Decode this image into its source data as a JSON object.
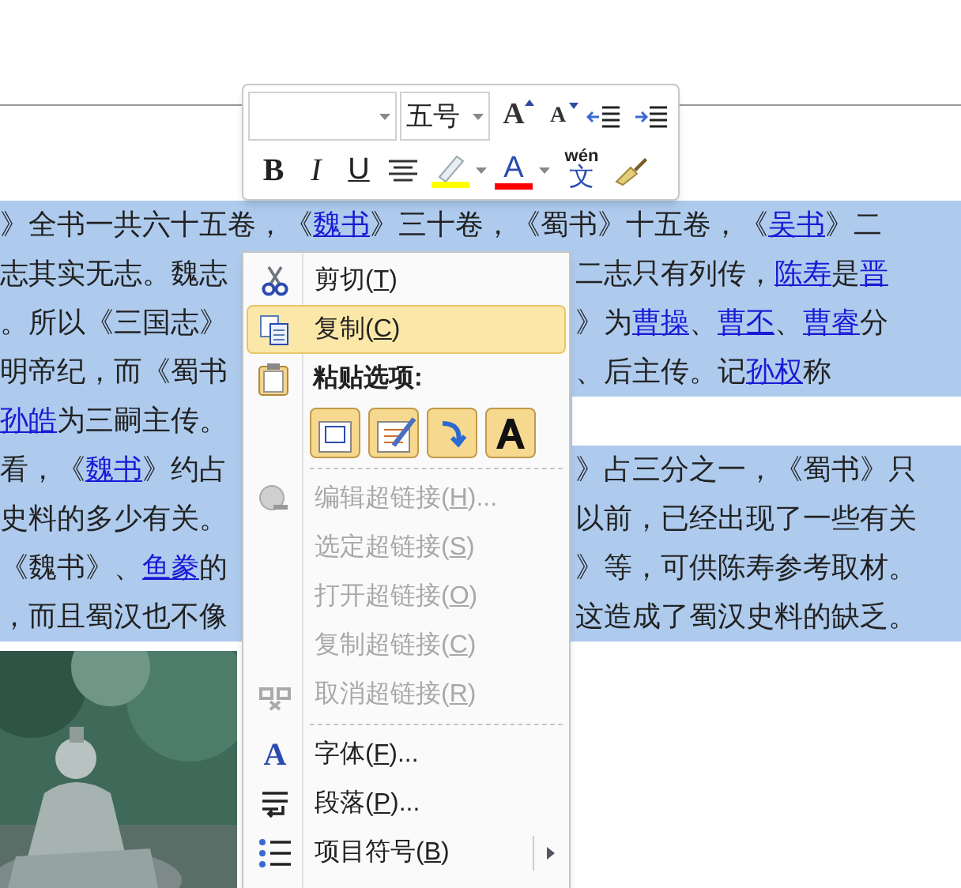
{
  "document": {
    "lines": [
      {
        "kind": "full",
        "left": {
          "selected": true,
          "runs": [
            {
              "text": "》全书一共六十五卷，《"
            },
            {
              "text": "魏书",
              "link": true
            },
            {
              "text": "》三十卷，《蜀书》十五卷，《"
            },
            {
              "text": "吴书",
              "link": true
            },
            {
              "text": "》二"
            }
          ]
        }
      },
      {
        "kind": "split",
        "left": {
          "selected": true,
          "runs": [
            {
              "text": "志其实无志。魏志"
            }
          ]
        },
        "right": {
          "selected": true,
          "runs": [
            {
              "text": "二志只有列传，"
            },
            {
              "text": "陈寿",
              "link": true
            },
            {
              "text": "是"
            },
            {
              "text": "晋",
              "link": true
            }
          ]
        }
      },
      {
        "kind": "split",
        "left": {
          "selected": true,
          "runs": [
            {
              "text": "。所以《三国志》"
            }
          ]
        },
        "right": {
          "selected": true,
          "runs": [
            {
              "text": "》为"
            },
            {
              "text": "曹操",
              "link": true
            },
            {
              "text": "、"
            },
            {
              "text": "曹丕",
              "link": true
            },
            {
              "text": "、"
            },
            {
              "text": "曹睿",
              "link": true
            },
            {
              "text": "分"
            }
          ]
        }
      },
      {
        "kind": "split",
        "left": {
          "selected": true,
          "runs": [
            {
              "text": "明帝纪，而《蜀书"
            }
          ]
        },
        "right": {
          "selected": true,
          "runs": [
            {
              "text": "、后主传。记"
            },
            {
              "text": "孙权",
              "link": true
            },
            {
              "text": "称"
            }
          ]
        }
      },
      {
        "kind": "split",
        "left": {
          "selected": true,
          "runs": [
            {
              "text": "孙皓",
              "link": true
            },
            {
              "text": "为三嗣主传。"
            }
          ]
        }
      },
      {
        "kind": "split",
        "left": {
          "selected": true,
          "runs": [
            {
              "text": "看，《"
            },
            {
              "text": "魏书",
              "link": true
            },
            {
              "text": "》约占"
            }
          ]
        },
        "right": {
          "selected": true,
          "runs": [
            {
              "text": "》占三分之一，《蜀书》只"
            }
          ]
        }
      },
      {
        "kind": "split",
        "left": {
          "selected": true,
          "runs": [
            {
              "text": "史料的多少有关。"
            }
          ]
        },
        "right": {
          "selected": true,
          "runs": [
            {
              "text": "以前，已经出现了一些有关"
            }
          ]
        }
      },
      {
        "kind": "split",
        "left": {
          "selected": true,
          "runs": [
            {
              "text": "《魏书》、"
            },
            {
              "text": "鱼豢",
              "link": true
            },
            {
              "text": "的"
            }
          ]
        },
        "right": {
          "selected": true,
          "runs": [
            {
              "text": "》等，可供陈寿参考取材。"
            }
          ]
        }
      },
      {
        "kind": "split",
        "left": {
          "selected": true,
          "runs": [
            {
              "text": "，而且蜀汉也不像"
            }
          ]
        },
        "right": {
          "selected": true,
          "runs": [
            {
              "text": "这造成了蜀汉史料的缺乏。"
            }
          ]
        }
      }
    ]
  },
  "mini_toolbar": {
    "font_size": {
      "value": "五号"
    },
    "grow_font": "A",
    "shrink_font": "A",
    "bold": "B",
    "italic": "I",
    "underline": "U",
    "highlight": {
      "color": "#ffff00"
    },
    "font_color": {
      "letter": "A",
      "color": "#ff0000"
    },
    "phonetic": {
      "pinyin": "wén",
      "char": "文"
    }
  },
  "context_menu": {
    "items": [
      {
        "kind": "item",
        "label": "剪切(",
        "key": "T",
        "tail": ")",
        "disabled": false,
        "selected": false
      },
      {
        "kind": "item",
        "label": "复制(",
        "key": "C",
        "tail": ")",
        "disabled": false,
        "selected": true
      },
      {
        "kind": "header",
        "label": "粘贴选项:"
      },
      {
        "kind": "paste_options"
      },
      {
        "kind": "separator"
      },
      {
        "kind": "item",
        "label": "编辑超链接(",
        "key": "H",
        "tail": ")...",
        "disabled": true,
        "selected": false
      },
      {
        "kind": "item",
        "label": "选定超链接(",
        "key": "S",
        "tail": ")",
        "disabled": true,
        "selected": false
      },
      {
        "kind": "item",
        "label": "打开超链接(",
        "key": "O",
        "tail": ")",
        "disabled": true,
        "selected": false
      },
      {
        "kind": "item",
        "label": "复制超链接(",
        "key": "C",
        "tail": ")",
        "disabled": true,
        "selected": false
      },
      {
        "kind": "item",
        "label": "取消超链接(",
        "key": "R",
        "tail": ")",
        "disabled": true,
        "selected": false
      },
      {
        "kind": "separator"
      },
      {
        "kind": "item",
        "label": "字体(",
        "key": "F",
        "tail": ")...",
        "font_letter": "A",
        "disabled": false,
        "selected": false
      },
      {
        "kind": "item",
        "label": "段落(",
        "key": "P",
        "tail": ")...",
        "disabled": false,
        "selected": false
      },
      {
        "kind": "item",
        "label": "项目符号(",
        "key": "B",
        "tail": ")",
        "submenu": true,
        "disabled": false,
        "selected": false
      }
    ]
  }
}
